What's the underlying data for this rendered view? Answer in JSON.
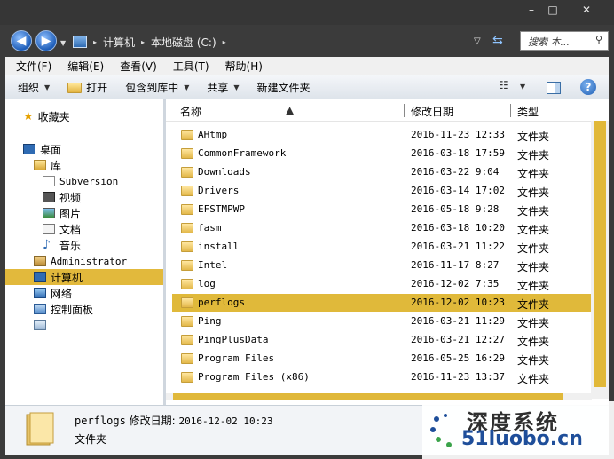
{
  "window": {
    "controls": [
      "–",
      "□",
      "✕"
    ]
  },
  "address": {
    "breadcrumbs": [
      "计算机",
      "本地磁盘 (C:)"
    ],
    "search_placeholder": "搜索 本...",
    "search_icon": "magnifier-icon"
  },
  "menu": [
    "文件(F)",
    "编辑(E)",
    "查看(V)",
    "工具(T)",
    "帮助(H)"
  ],
  "toolbar": {
    "organize": "组织",
    "open": "打开",
    "include_library": "包含到库中",
    "share": "共享",
    "new_folder": "新建文件夹"
  },
  "nav": {
    "favorites": "收藏夹",
    "desktop": "桌面",
    "libraries": "库",
    "subversion": "Subversion",
    "videos": "视频",
    "pictures": "图片",
    "documents": "文档",
    "music": "音乐",
    "administrator": "Administrator",
    "computer": "计算机",
    "network": "网络",
    "control_panel": "控制面板"
  },
  "columns": {
    "name": "名称",
    "modified": "修改日期",
    "type": "类型"
  },
  "files": [
    {
      "name": "AHtmp",
      "date": "2016-11-23 12:33",
      "type": "文件夹"
    },
    {
      "name": "CommonFramework",
      "date": "2016-03-18 17:59",
      "type": "文件夹"
    },
    {
      "name": "Downloads",
      "date": "2016-03-22 9:04",
      "type": "文件夹"
    },
    {
      "name": "Drivers",
      "date": "2016-03-14 17:02",
      "type": "文件夹"
    },
    {
      "name": "EFSTMPWP",
      "date": "2016-05-18 9:28",
      "type": "文件夹"
    },
    {
      "name": "fasm",
      "date": "2016-03-18 10:20",
      "type": "文件夹"
    },
    {
      "name": "install",
      "date": "2016-03-21 11:22",
      "type": "文件夹"
    },
    {
      "name": "Intel",
      "date": "2016-11-17 8:27",
      "type": "文件夹"
    },
    {
      "name": "log",
      "date": "2016-12-02 7:35",
      "type": "文件夹"
    },
    {
      "name": "perflogs",
      "date": "2016-12-02 10:23",
      "type": "文件夹"
    },
    {
      "name": "Ping",
      "date": "2016-03-21 11:29",
      "type": "文件夹"
    },
    {
      "name": "PingPlusData",
      "date": "2016-03-21 12:27",
      "type": "文件夹"
    },
    {
      "name": "Program Files",
      "date": "2016-05-25 16:29",
      "type": "文件夹"
    },
    {
      "name": "Program Files (x86)",
      "date": "2016-11-23 13:37",
      "type": "文件夹"
    }
  ],
  "details": {
    "name": "perflogs",
    "modified_label": "修改日期:",
    "modified_value": "2016-12-02 10:23",
    "type": "文件夹"
  },
  "watermark": {
    "line1": "深度系统",
    "line2": "51luobo.cn"
  }
}
